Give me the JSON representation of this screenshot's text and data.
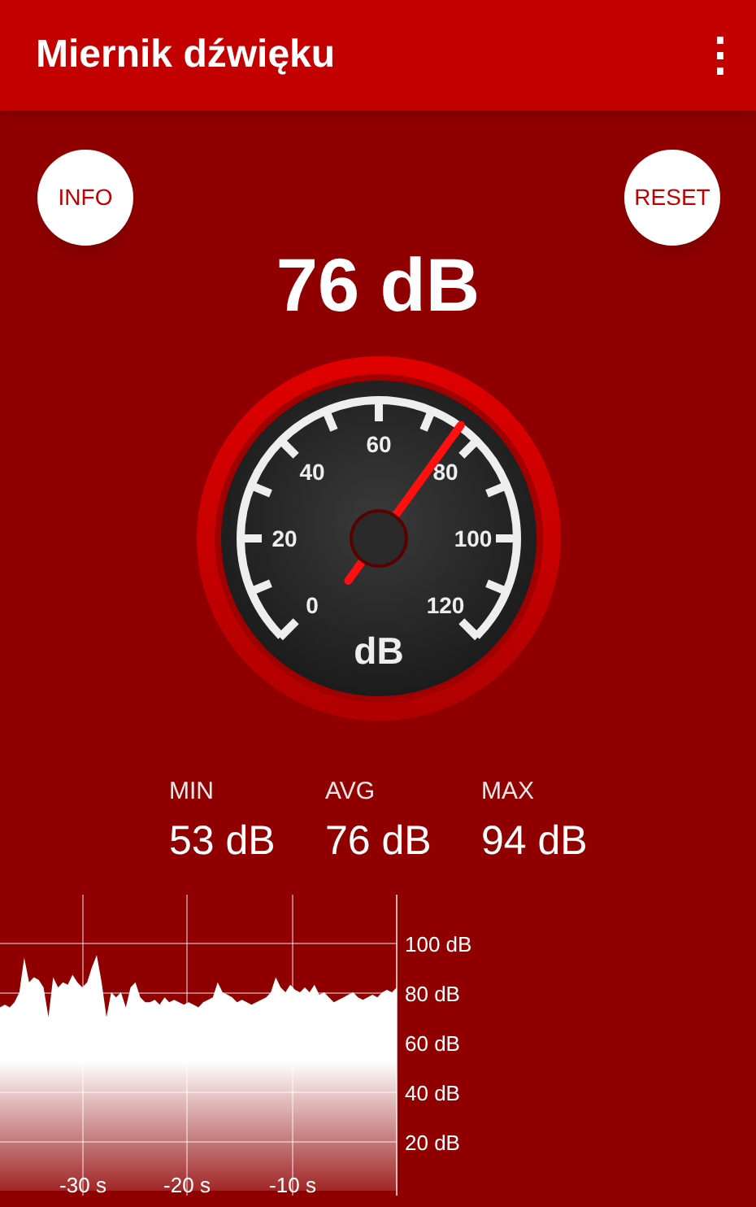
{
  "app_bar": {
    "title": "Miernik dźwięku",
    "menu_icon": "⋮"
  },
  "buttons": {
    "info": "INFO",
    "reset": "RESET"
  },
  "reading": "76 dB",
  "gauge": {
    "unit": "dB",
    "scale_labels": [
      "0",
      "20",
      "40",
      "60",
      "80",
      "100",
      "120"
    ]
  },
  "stats": [
    {
      "label": "MIN",
      "value": "53 dB"
    },
    {
      "label": "AVG",
      "value": "76 dB"
    },
    {
      "label": "MAX",
      "value": "94 dB"
    }
  ],
  "history": {
    "y_labels": [
      "100 dB",
      "80 dB",
      "60 dB",
      "40 dB",
      "20 dB"
    ],
    "x_labels": [
      "-30 s",
      "-20 s",
      "-10 s"
    ]
  }
}
